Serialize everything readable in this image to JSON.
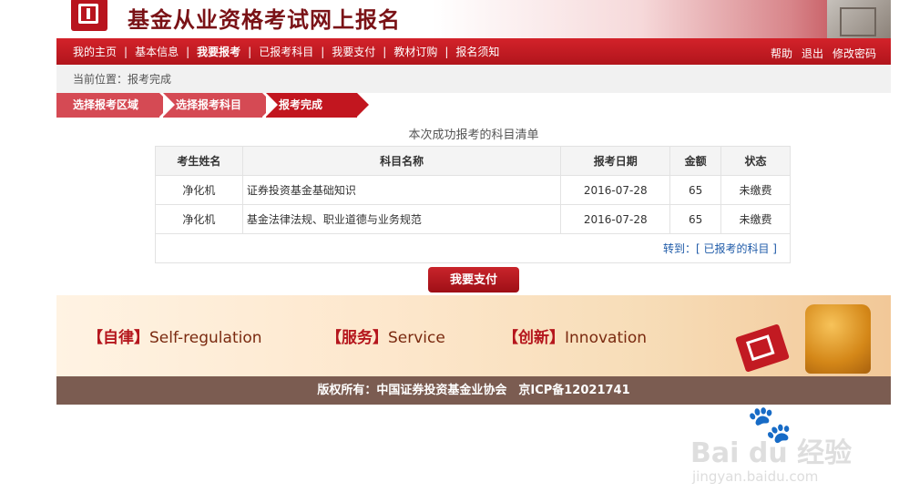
{
  "header": {
    "title": "基金从业资格考试网上报名"
  },
  "nav": {
    "left_items": [
      {
        "label": "我的主页",
        "bold": false
      },
      {
        "label": "基本信息",
        "bold": false
      },
      {
        "label": "我要报考",
        "bold": true
      },
      {
        "label": "已报考科目",
        "bold": false
      },
      {
        "label": "我要支付",
        "bold": false
      },
      {
        "label": "教材订购",
        "bold": false
      },
      {
        "label": "报名须知",
        "bold": false
      }
    ],
    "separator": "|",
    "right_items": [
      "帮助",
      "退出",
      "修改密码"
    ]
  },
  "breadcrumb": {
    "text": "当前位置：报考完成"
  },
  "steps": [
    "选择报考区域",
    "选择报考科目",
    "报考完成"
  ],
  "list_title": "本次成功报考的科目清单",
  "table": {
    "headers": [
      "考生姓名",
      "科目名称",
      "报考日期",
      "金额",
      "状态"
    ],
    "rows": [
      [
        "净化机",
        "证券投资基金基础知识",
        "2016-07-28",
        "65",
        "未缴费"
      ],
      [
        "净化机",
        "基金法律法规、职业道德与业务规范",
        "2016-07-28",
        "65",
        "未缴费"
      ]
    ],
    "footer_prefix": "转到：",
    "footer_link": "[ 已报考的科目 ]"
  },
  "pay_button": "我要支付",
  "banner": {
    "mottos": [
      {
        "cn": "【自律】",
        "en": "Self-regulation"
      },
      {
        "cn": "【服务】",
        "en": "Service"
      },
      {
        "cn": "【创新】",
        "en": "Innovation"
      }
    ]
  },
  "footer": {
    "copyright": "版权所有：中国证券投资基金业协会　京ICP备12021741"
  },
  "watermark": {
    "logo_text": "Bai du 经验",
    "url": "jingyan.baidu.com"
  },
  "colors": {
    "nav_red": "#c2161f",
    "step_light": "#d54a54",
    "footer_brown": "#7b5c51",
    "link_blue": "#1e5aa8"
  }
}
